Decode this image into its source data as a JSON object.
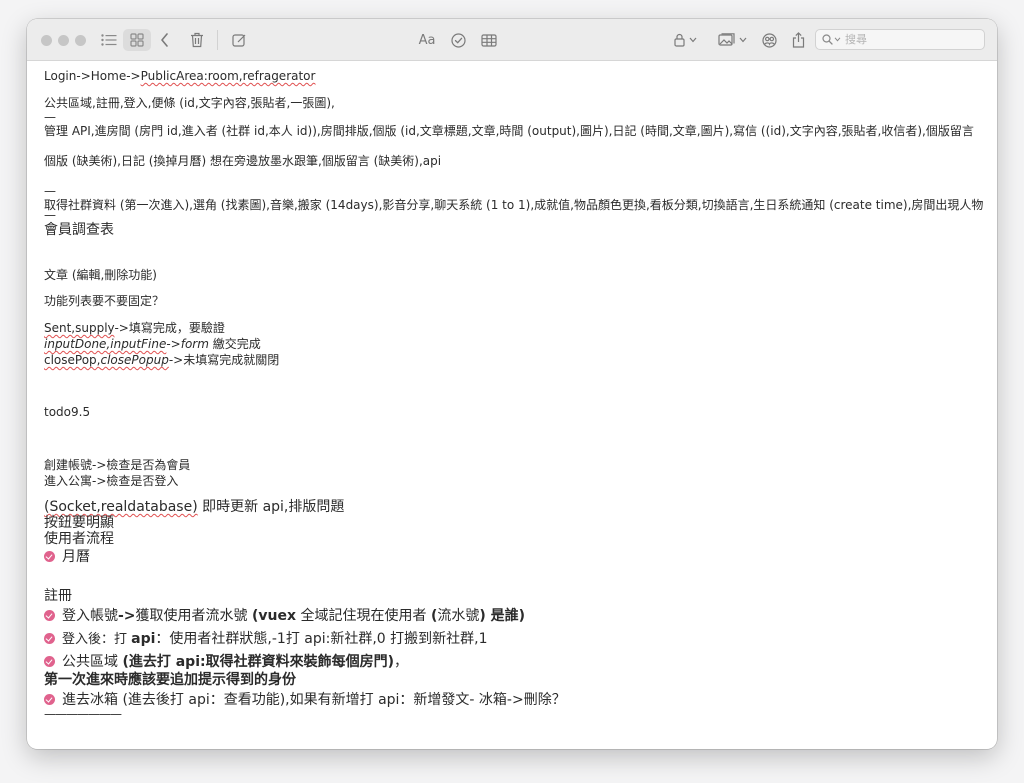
{
  "toolbar": {
    "search_placeholder": "搜尋",
    "format_label": "Aa"
  },
  "note": {
    "path_prefix": "Login->Home->",
    "path_link": "PublicArea:room,refragerator",
    "l_public": "公共區域,註冊,登入,便條 (id,文字內容,張貼者,一張圖),",
    "dash1": "—",
    "l_api1": "管理 API,進房間 (房門 id,進入者 (社群 id,本人 id)),房間排版,個版 (id,文章標題,文章,時間 (output),圖片),日記 (時間,文章,圖片),寫信 ((id),文字內容,張貼者,收信者),個版留言",
    "l_api2": "個版 (缺美術),日記 (換掉月曆) 想在旁邊放墨水跟筆,個版留言 (缺美術),api",
    "dash2": "—",
    "l_social": "取得社群資料 (第一次進入),選角 (找素圖),音樂,搬家 (14days),影音分享,聊天系統 (1 to 1),成就值,物品顏色更換,看板分類,切換語言,生日系統通知 (create time),房間出現人物",
    "dash3": "—",
    "heading_survey": "會員調查表",
    "l_article": "文章 (編輯,刪除功能)",
    "l_fixed": "功能列表要不要固定？",
    "sent_a": "Sent,supply",
    "sent_b": "->填寫完成，要驗證",
    "input_a": "inputDone,inputFine",
    "input_b": "->",
    "input_c": "form",
    "input_d": " 繳交完成",
    "close_a": "closePop,",
    "close_b": "closePopup",
    "close_c": "->未填寫完成就關閉",
    "todo": "todo9.5",
    "create_acc": "創建帳號->檢查是否為會員",
    "enter_apt": "進入公寓->檢查是否登入",
    "socket_a": "(Socket,realdatabase)",
    "socket_b": " 即時更新 api,排版問題",
    "btn_clear": "按鈕要明顯",
    "user_flow": "使用者流程",
    "calendar": "月曆",
    "register": "註冊",
    "r1_a": "登入帳號",
    "r1_b": "->",
    "r1_c": "獲取使用者流水號 ",
    "r1_d": "(vuex",
    "r1_e": " 全域記住現在使用者 ",
    "r1_f": "(",
    "r1_g": "流水號",
    "r1_h": ") 是誰)",
    "r2_a": "登入後：打 ",
    "r2_b": "api",
    "r2_c": "：使用者社群狀態,-1打 api:新社群,0 打搬到新社群,1",
    "r3_a": "公共區域 ",
    "r3_b": "(進去打 api:取得社群資料來裝飾每個房門)",
    "r3_c": "，",
    "r3_line2": "第一次進來時應該要追加提示得到的身份",
    "r4": "進去冰箱 (進去後打 api：查看功能),如果有新增打 api：新增發文- 冰箱->刪除？",
    "underline_bar": "———————"
  }
}
